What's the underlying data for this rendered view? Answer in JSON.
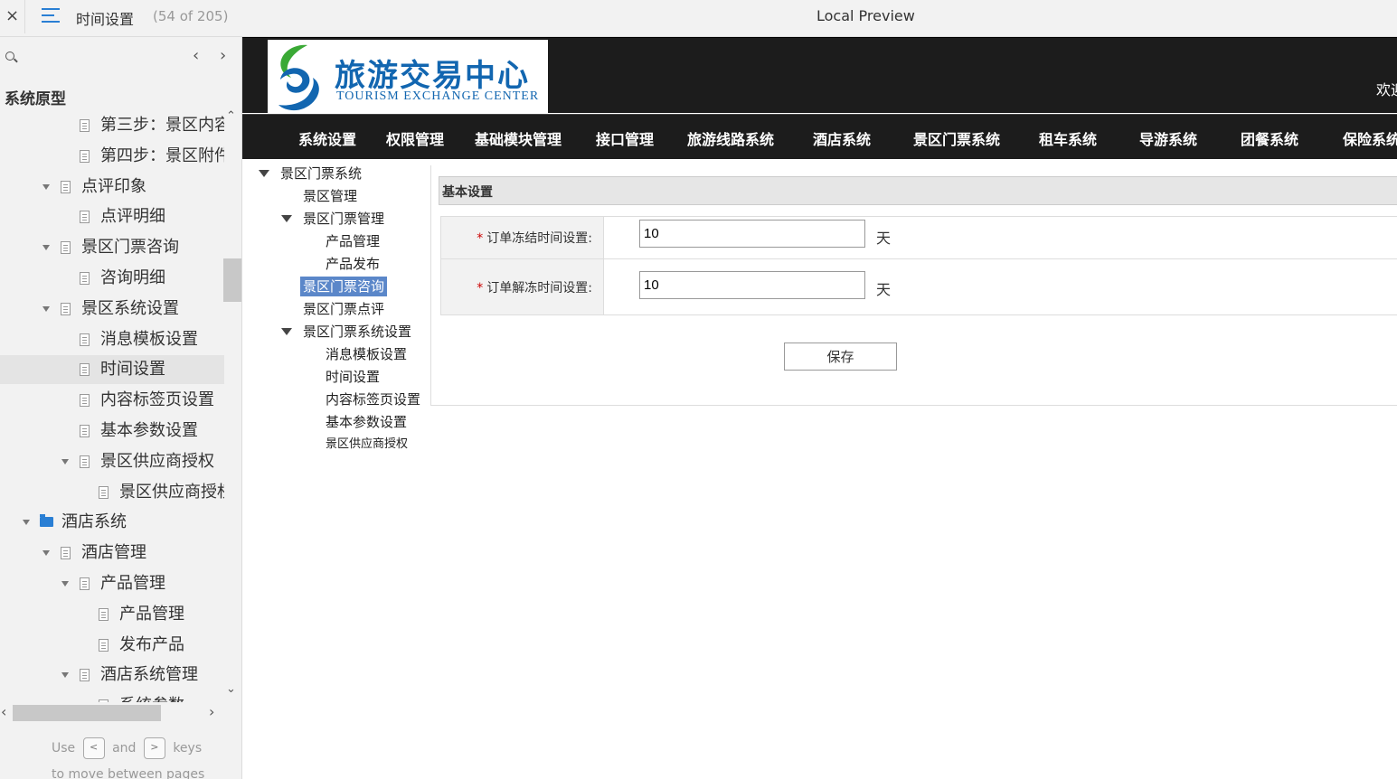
{
  "topbar": {
    "close": "×",
    "page_title": "时间设置",
    "page_count": "(54 of 205)",
    "preview_title": "Local Preview"
  },
  "sitemap": {
    "title": "系统原型",
    "prev": "‹",
    "next": "›",
    "nodes": [
      {
        "label": "第三步：景区内容",
        "icon": "page"
      },
      {
        "label": "第四步：景区附件",
        "icon": "page"
      },
      {
        "label": "点评印象",
        "icon": "page",
        "expanded": true
      },
      {
        "label": "点评明细",
        "icon": "page"
      },
      {
        "label": "景区门票咨询",
        "icon": "page",
        "expanded": true
      },
      {
        "label": "咨询明细",
        "icon": "page"
      },
      {
        "label": "景区系统设置",
        "icon": "page",
        "expanded": true
      },
      {
        "label": "消息模板设置",
        "icon": "page"
      },
      {
        "label": "时间设置",
        "icon": "page",
        "selected": true
      },
      {
        "label": "内容标签页设置",
        "icon": "page"
      },
      {
        "label": "基本参数设置",
        "icon": "page"
      },
      {
        "label": "景区供应商授权",
        "icon": "page",
        "expanded": true
      },
      {
        "label": "景区供应商授权",
        "icon": "page"
      },
      {
        "label": "酒店系统",
        "icon": "folder",
        "expanded": true
      },
      {
        "label": "酒店管理",
        "icon": "page",
        "expanded": true
      },
      {
        "label": "产品管理",
        "icon": "page",
        "expanded": true
      },
      {
        "label": "产品管理",
        "icon": "page"
      },
      {
        "label": "发布产品",
        "icon": "page"
      },
      {
        "label": "酒店系统管理",
        "icon": "page",
        "expanded": true
      },
      {
        "label": "系统参数",
        "icon": "page"
      }
    ],
    "hint_use": "Use",
    "hint_and": "and",
    "hint_keys": "keys",
    "hint_line2": "to move between pages",
    "key_prev": "<",
    "key_next": ">"
  },
  "site": {
    "logo_cn": "旅游交易中心",
    "logo_en": "TOURISM EXCHANGE CENTER",
    "welcome": "欢迎",
    "nav": [
      "系统设置",
      "权限管理",
      "基础模块管理",
      "接口管理",
      "旅游线路系统",
      "酒店系统",
      "景区门票系统",
      "租车系统",
      "导游系统",
      "团餐系统",
      "保险系统"
    ]
  },
  "subtree": {
    "root": "景区门票系统",
    "items": [
      "景区管理",
      "景区门票管理",
      "产品管理",
      "产品发布",
      "景区门票咨询",
      "景区门票点评",
      "景区门票系统设置",
      "消息模板设置",
      "时间设置",
      "内容标签页设置",
      "基本参数设置",
      "景区供应商授权"
    ]
  },
  "form": {
    "section_title": "基本设置",
    "required_mark": "*",
    "freeze_label": "订单冻结时间设置:",
    "freeze_value": "10",
    "unfreeze_label": "订单解冻时间设置:",
    "unfreeze_value": "10",
    "unit": "天",
    "save": "保存"
  },
  "colors": {
    "accent": "#2a7fd4",
    "header_bg": "#1c1c1c",
    "highlight": "#5b87c9",
    "required": "#cc0000"
  }
}
